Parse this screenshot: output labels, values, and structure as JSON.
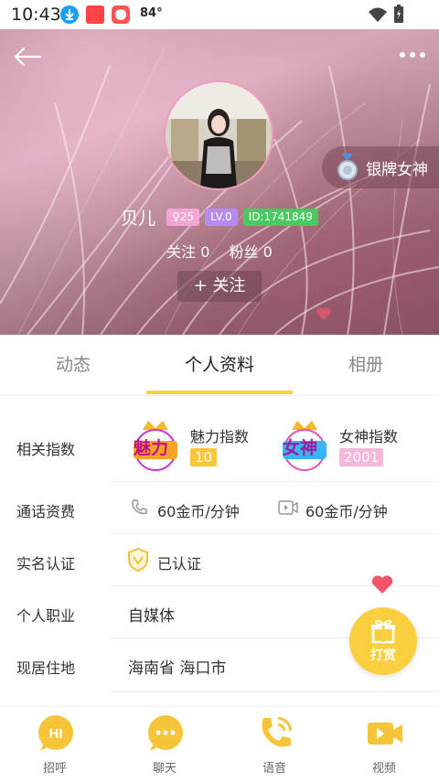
{
  "status_bar": {
    "time": "10:43",
    "temperature": "84°"
  },
  "profile": {
    "name": "贝儿",
    "age_tag": "25",
    "level_tag": "LV.0",
    "id_tag": "ID:1741849",
    "badge_label": "银牌女神",
    "following_text": "关注 0",
    "fans_text": "粉丝 0",
    "follow_button": "+ 关注"
  },
  "tabs": [
    {
      "label": "动态",
      "active": false
    },
    {
      "label": "个人资料",
      "active": true
    },
    {
      "label": "相册",
      "active": false
    }
  ],
  "details": {
    "index_label": "相关指数",
    "charm": {
      "logo_text": "魅力",
      "title": "魅力指数",
      "value": "10"
    },
    "goddess": {
      "logo_text": "女神",
      "title": "女神指数",
      "value": "2001"
    },
    "fee_label": "通话资费",
    "voice_fee": "60金币/分钟",
    "video_fee": "60金币/分钟",
    "verify_label": "实名认证",
    "verify_value": "已认证",
    "job_label": "个人职业",
    "job_value": "自媒体",
    "city_label": "现居住地",
    "city_value": "海南省 海口市"
  },
  "gift_button": "打赏",
  "bottom_nav": [
    {
      "label": "招呼",
      "icon": "hi-icon"
    },
    {
      "label": "聊天",
      "icon": "chat-icon"
    },
    {
      "label": "语音",
      "icon": "phone-icon"
    },
    {
      "label": "视频",
      "icon": "video-icon"
    }
  ],
  "colors": {
    "accent": "#f5d33f",
    "gift": "#f9cf3f",
    "nav_icon": "#f7c53a"
  }
}
